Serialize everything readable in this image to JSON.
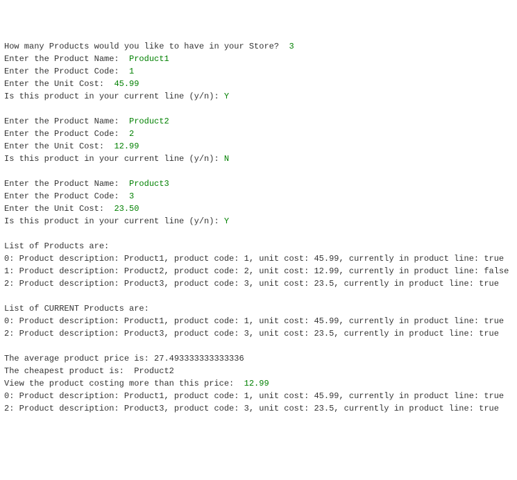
{
  "lines": [
    {
      "prompt": "How many Products would you like to have in your Store?  ",
      "input": "3"
    },
    {
      "prompt": "Enter the Product Name:  ",
      "input": "Product1"
    },
    {
      "prompt": "Enter the Product Code:  ",
      "input": "1"
    },
    {
      "prompt": "Enter the Unit Cost:  ",
      "input": "45.99"
    },
    {
      "prompt": "Is this product in your current line (y/n): ",
      "input": "Y"
    },
    {
      "blank": true
    },
    {
      "prompt": "Enter the Product Name:  ",
      "input": "Product2"
    },
    {
      "prompt": "Enter the Product Code:  ",
      "input": "2"
    },
    {
      "prompt": "Enter the Unit Cost:  ",
      "input": "12.99"
    },
    {
      "prompt": "Is this product in your current line (y/n): ",
      "input": "N"
    },
    {
      "blank": true
    },
    {
      "prompt": "Enter the Product Name:  ",
      "input": "Product3"
    },
    {
      "prompt": "Enter the Product Code:  ",
      "input": "3"
    },
    {
      "prompt": "Enter the Unit Cost:  ",
      "input": "23.50"
    },
    {
      "prompt": "Is this product in your current line (y/n): ",
      "input": "Y"
    },
    {
      "blank": true
    },
    {
      "prompt": "List of Products are:",
      "input": ""
    },
    {
      "prompt": "0: Product description: Product1, product code: 1, unit cost: 45.99, currently in product line: true",
      "input": ""
    },
    {
      "prompt": "1: Product description: Product2, product code: 2, unit cost: 12.99, currently in product line: false",
      "input": ""
    },
    {
      "prompt": "2: Product description: Product3, product code: 3, unit cost: 23.5, currently in product line: true",
      "input": ""
    },
    {
      "blank": true
    },
    {
      "prompt": "List of CURRENT Products are:",
      "input": ""
    },
    {
      "prompt": "0: Product description: Product1, product code: 1, unit cost: 45.99, currently in product line: true",
      "input": ""
    },
    {
      "prompt": "2: Product description: Product3, product code: 3, unit cost: 23.5, currently in product line: true",
      "input": ""
    },
    {
      "blank": true
    },
    {
      "prompt": "The average product price is: 27.493333333333336",
      "input": ""
    },
    {
      "prompt": "The cheapest product is:  Product2",
      "input": ""
    },
    {
      "prompt": "View the product costing more than this price:  ",
      "input": "12.99"
    },
    {
      "prompt": "0: Product description: Product1, product code: 1, unit cost: 45.99, currently in product line: true",
      "input": ""
    },
    {
      "prompt": "2: Product description: Product3, product code: 3, unit cost: 23.5, currently in product line: true",
      "input": ""
    }
  ]
}
